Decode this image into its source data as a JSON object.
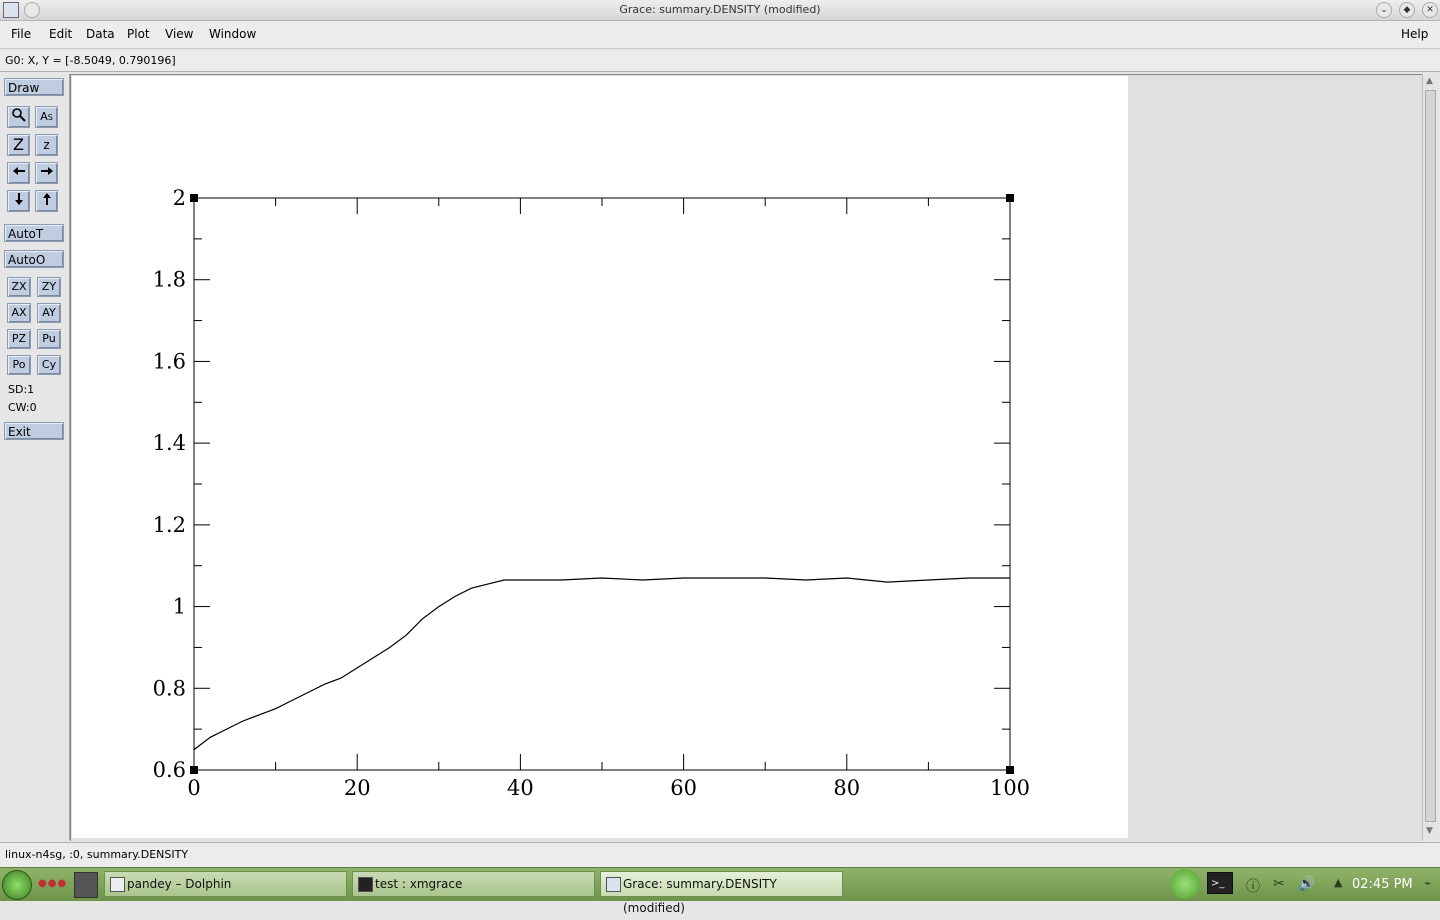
{
  "window": {
    "title": "Grace: summary.DENSITY (modified)"
  },
  "menubar": {
    "items": [
      "File",
      "Edit",
      "Data",
      "Plot",
      "View",
      "Window"
    ],
    "help": "Help"
  },
  "location": "G0: X, Y = [-8.5049, 0.790196]",
  "toolbar": {
    "draw": "Draw",
    "autot": "AutoT",
    "autoo": "AutoO",
    "small_buttons": [
      "ZX",
      "ZY",
      "AX",
      "AY",
      "PZ",
      "Pu",
      "Po",
      "Cy"
    ],
    "sd": "SD:1",
    "cw": "CW:0",
    "exit": "Exit",
    "icons": [
      "zoom-icon",
      "text-edit-icon",
      "zoom-in-icon",
      "zoom-out-icon",
      "arrow-left-icon",
      "arrow-right-icon",
      "arrow-down-icon",
      "arrow-up-icon"
    ]
  },
  "status": "linux-n4sg, :0, summary.DENSITY",
  "taskbar": {
    "tasks": [
      {
        "label": "pandey – Dolphin",
        "active": false
      },
      {
        "label": "test : xmgrace",
        "active": false
      },
      {
        "label": "Grace: summary.DENSITY (modified)",
        "active": true
      }
    ],
    "clock": "02:45 PM"
  },
  "chart_data": {
    "type": "line",
    "title": "",
    "xlabel": "",
    "ylabel": "",
    "xlim": [
      0,
      100
    ],
    "ylim": [
      0.6,
      2
    ],
    "x_ticks": [
      "0",
      "20",
      "40",
      "60",
      "80",
      "100"
    ],
    "y_ticks": [
      "0.6",
      "0.8",
      "1",
      "1.2",
      "1.4",
      "1.6",
      "1.8",
      "2"
    ],
    "grid": false,
    "series": [
      {
        "x": [
          0,
          2,
          4,
          6,
          8,
          10,
          12,
          14,
          16,
          18,
          20,
          22,
          24,
          26,
          28,
          30,
          32,
          34,
          36,
          38,
          40,
          45,
          50,
          55,
          60,
          65,
          70,
          75,
          80,
          85,
          90,
          95,
          100
        ],
        "y": [
          0.65,
          0.68,
          0.7,
          0.72,
          0.735,
          0.75,
          0.77,
          0.79,
          0.81,
          0.825,
          0.85,
          0.875,
          0.9,
          0.93,
          0.97,
          1.0,
          1.025,
          1.045,
          1.055,
          1.065,
          1.065,
          1.065,
          1.07,
          1.065,
          1.07,
          1.07,
          1.07,
          1.065,
          1.07,
          1.06,
          1.065,
          1.07,
          1.07
        ]
      }
    ]
  }
}
